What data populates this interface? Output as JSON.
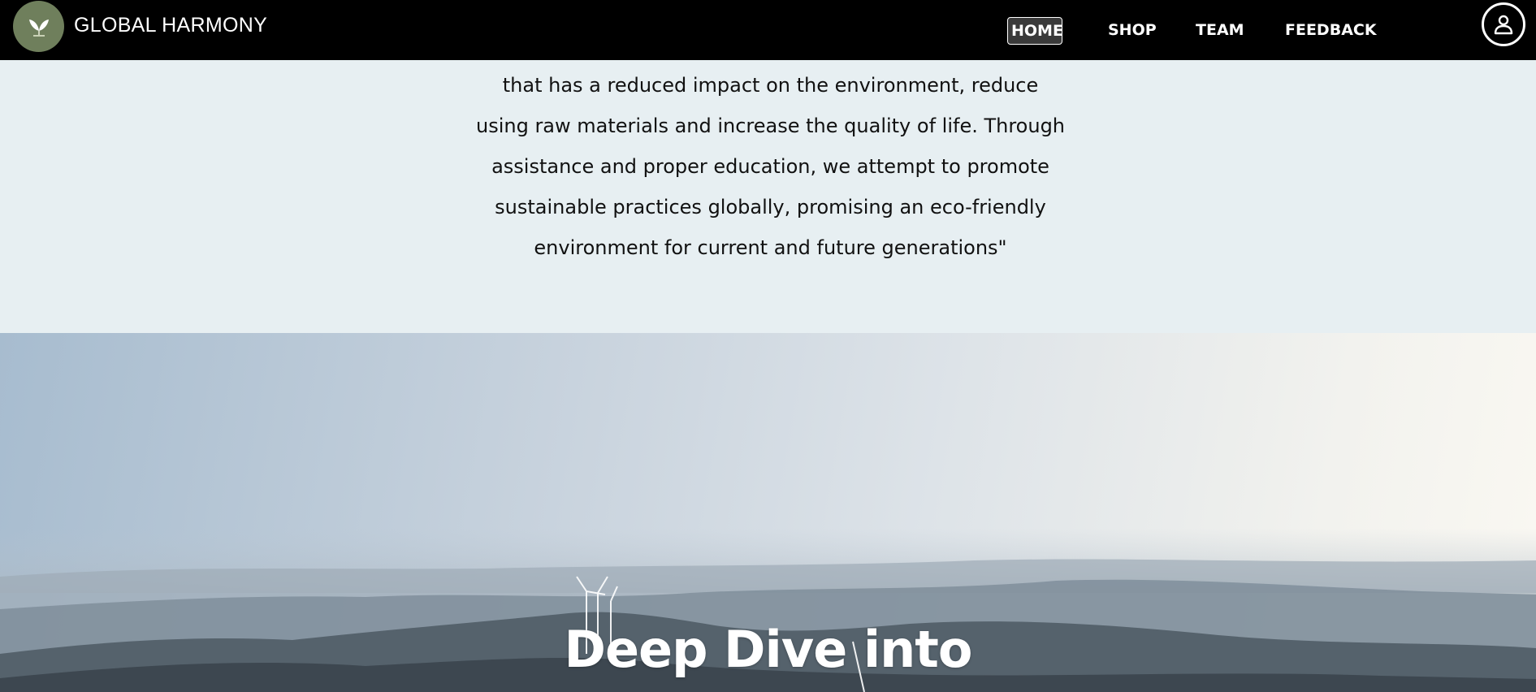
{
  "header": {
    "brand": "GLOBAL HARMONY",
    "logo_icon": "leaf-icon",
    "nav": [
      {
        "label": "HOME",
        "active": true
      },
      {
        "label": "SHOP",
        "active": false
      },
      {
        "label": "TEAM",
        "active": false
      },
      {
        "label": "FEEDBACK",
        "active": false
      }
    ],
    "account_icon": "user-icon"
  },
  "mission": {
    "lines": [
      "that has a reduced impact on the environment, reduce",
      "using raw materials and increase the quality of life. Through",
      "assistance and proper education, we attempt to promote",
      "sustainable practices globally, promising an eco-friendly",
      "environment for current and future generations\""
    ]
  },
  "hero": {
    "title": "Deep Dive into",
    "background": "wind-turbine-mountain-landscape"
  },
  "colors": {
    "navbar": "#000000",
    "mission_bg": "#e7eff2",
    "logo_bg": "#6f7f5c"
  }
}
